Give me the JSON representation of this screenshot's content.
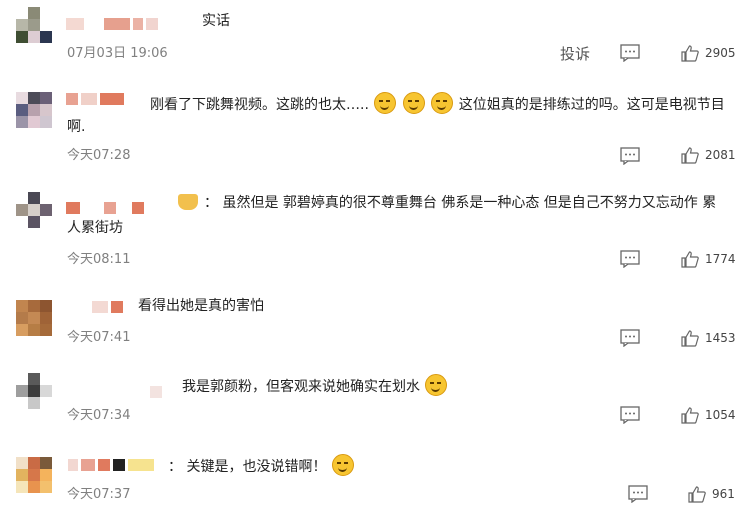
{
  "comments": [
    {
      "avatar_colors": [
        "#ffffff",
        "#8a8a76",
        "#ffffff",
        "#b7b7a8",
        "#9b9b8b",
        "#ffffff",
        "#3f4e33",
        "#ddcdd3",
        "#2b3650"
      ],
      "name_colors": [
        "#f4d9d2",
        "#ffffff",
        "#e6a08e",
        "#ebb2a5",
        "#f1d4cf"
      ],
      "text": "实话",
      "time": "07月03日 19:06",
      "report": "投诉",
      "likes": "2905"
    },
    {
      "avatar_colors": [
        "#e8dbe0",
        "#4c4b58",
        "#6b6078",
        "#5a5d80",
        "#b8a1ad",
        "#d7c6cc",
        "#9b94a8",
        "#e1c9d3",
        "#cfc6d0"
      ],
      "name_colors": [
        "#e8a292",
        "#f0d0c8",
        "#e07a5e"
      ],
      "text": "刚看了下跳舞视频。这跳的也太…..",
      "text_after_emojis": " 这位姐真的是排练过的吗。这可是电视节目",
      "text_line2": "啊.",
      "time": "今天07:28",
      "likes": "2081"
    },
    {
      "avatar_colors": [
        "#ffffff",
        "#4a4854",
        "#ffffff",
        "#9f9488",
        "#d6cfc9",
        "#6d6270",
        "#ffffff",
        "#5b5463",
        "#ffffff"
      ],
      "name_colors": [
        "#e07a5e",
        "#ffffff",
        "#e8a292",
        "#ffffff",
        "#e07a5e"
      ],
      "text": "： 虽然但是 郭碧婷真的很不尊重舞台 佛系是一种心态 但是自己不努力又忘动作 累",
      "text_line2": "人累街坊",
      "time": "今天08:11",
      "likes": "1774"
    },
    {
      "avatar_colors": [
        "#c1854f",
        "#a76a3c",
        "#8d5530",
        "#b47b4a",
        "#c48954",
        "#9f6337",
        "#d79d60",
        "#b67d45",
        "#a56a3a"
      ],
      "name_colors": [
        "#f3d9d3",
        "#e07a5e"
      ],
      "text": "看得出她是真的害怕",
      "time": "今天07:41",
      "likes": "1453"
    },
    {
      "avatar_colors": [
        "#ffffff",
        "#5a5a5a",
        "#ffffff",
        "#9e9e9e",
        "#3c3c3c",
        "#d8d8d8",
        "#ffffff",
        "#c8c8c8",
        "#ffffff"
      ],
      "name_colors": [
        "#f3e3e0"
      ],
      "text": "我是郭颜粉，但客观来说她确实在划水",
      "time": "今天07:34",
      "likes": "1054"
    },
    {
      "avatar_colors": [
        "#f1e0c8",
        "#c96b45",
        "#7a5a3a",
        "#e2b35f",
        "#d6774a",
        "#f4b35c",
        "#f5e5b9",
        "#e8934e",
        "#f3c06d"
      ],
      "name_colors": [
        "#f2d7d1",
        "#e8a292",
        "#e07a5e",
        "#222222",
        "#f6e38f"
      ],
      "text": "： 关键是，也没说错啊！",
      "time": "今天07:37",
      "likes": "961"
    }
  ],
  "icons": {
    "message": "message-icon",
    "like": "thumbs-up-icon",
    "emoji": "grimace-emoji-icon",
    "laugh": "laughing-emoji-icon",
    "crown": "crown-icon"
  }
}
